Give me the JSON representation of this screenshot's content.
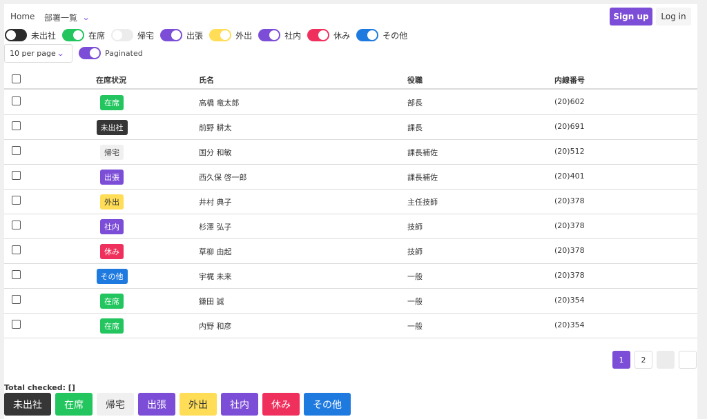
{
  "nav": {
    "home": "Home",
    "dept": "部署一覧",
    "signup": "Sign up",
    "login": "Log in"
  },
  "statuses": [
    {
      "key": "mishussha",
      "label": "未出社",
      "color": "#363636",
      "text_color": "#ffffff"
    },
    {
      "key": "zaiseki",
      "label": "在席",
      "color": "#22c55e",
      "text_color": "#ffffff"
    },
    {
      "key": "kitaku",
      "label": "帰宅",
      "color": "#f0f0f0",
      "text_color": "#363636"
    },
    {
      "key": "shutcho",
      "label": "出張",
      "color": "#7c4dd6",
      "text_color": "#ffffff"
    },
    {
      "key": "gaishutsu",
      "label": "外出",
      "color": "#ffdd57",
      "text_color": "#363636"
    },
    {
      "key": "shanai",
      "label": "社内",
      "color": "#7c4dd6",
      "text_color": "#ffffff"
    },
    {
      "key": "yasumi",
      "label": "休み",
      "color": "#f0305c",
      "text_color": "#ffffff"
    },
    {
      "key": "sonota",
      "label": "その他",
      "color": "#1f7ae0",
      "text_color": "#ffffff"
    }
  ],
  "filter_switches": [
    {
      "label": "未出社",
      "on": false,
      "color": "#2b2b2b"
    },
    {
      "label": "在席",
      "on": true,
      "color": "#22c55e"
    },
    {
      "label": "帰宅",
      "on": false,
      "color": "#ececec"
    },
    {
      "label": "出張",
      "on": true,
      "color": "#7c4dd6"
    },
    {
      "label": "外出",
      "on": true,
      "color": "#ffdd57"
    },
    {
      "label": "社内",
      "on": true,
      "color": "#7c4dd6"
    },
    {
      "label": "休み",
      "on": true,
      "color": "#f0305c"
    },
    {
      "label": "その他",
      "on": true,
      "color": "#1f7ae0"
    }
  ],
  "per_page": "10 per page",
  "paginated_label": "Paginated",
  "table": {
    "headers": [
      "在席状況",
      "氏名",
      "役職",
      "内線番号"
    ],
    "rows": [
      {
        "status": "在席",
        "name": "高橋 竜太郎",
        "title": "部長",
        "ext": "(20)602"
      },
      {
        "status": "未出社",
        "name": "前野 耕太",
        "title": "課長",
        "ext": "(20)691"
      },
      {
        "status": "帰宅",
        "name": "国分 和敏",
        "title": "課長補佐",
        "ext": "(20)512"
      },
      {
        "status": "出張",
        "name": "西久保 啓一郎",
        "title": "課長補佐",
        "ext": "(20)401"
      },
      {
        "status": "外出",
        "name": "井村 典子",
        "title": "主任技師",
        "ext": "(20)378"
      },
      {
        "status": "社内",
        "name": "杉澤 弘子",
        "title": "技師",
        "ext": "(20)378"
      },
      {
        "status": "休み",
        "name": "草柳 由起",
        "title": "技師",
        "ext": "(20)378"
      },
      {
        "status": "その他",
        "name": "宇梶 未来",
        "title": "一般",
        "ext": "(20)378"
      },
      {
        "status": "在席",
        "name": "鎌田 誠",
        "title": "一般",
        "ext": "(20)354"
      },
      {
        "status": "在席",
        "name": "内野 和彦",
        "title": "一般",
        "ext": "(20)354"
      }
    ]
  },
  "pagination": {
    "pages": [
      "1",
      "2",
      "",
      ""
    ],
    "current": "1"
  },
  "total_checked": "Total checked: []",
  "bottom_buttons": [
    "未出社",
    "在席",
    "帰宅",
    "出張",
    "外出",
    "社内",
    "休み",
    "その他"
  ]
}
